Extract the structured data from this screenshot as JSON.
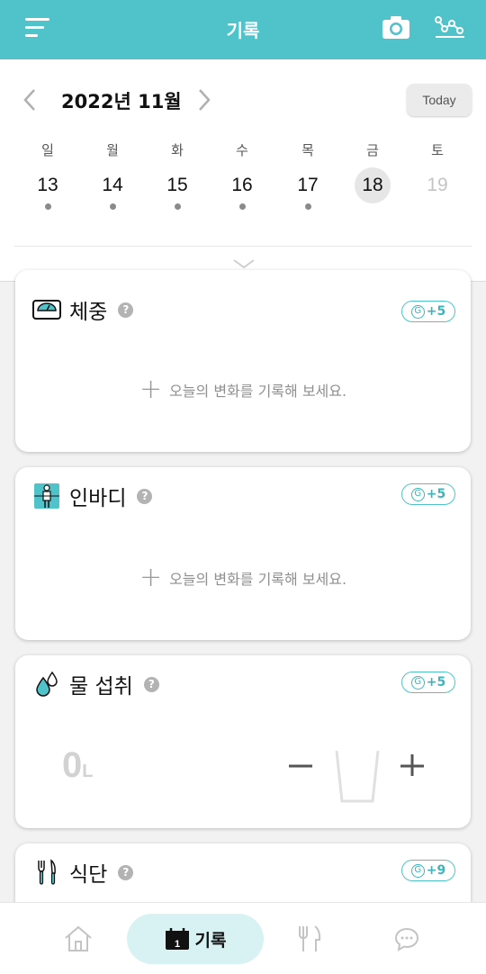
{
  "header": {
    "title": "기록",
    "menu_icon": "menu-icon",
    "camera_icon": "camera-icon",
    "graph_icon": "graph-icon"
  },
  "calendar": {
    "month_title": "2022년 11월",
    "today_label": "Today",
    "days": [
      {
        "dow": "일",
        "date": "13",
        "has_record": true,
        "selected": false,
        "future": false
      },
      {
        "dow": "월",
        "date": "14",
        "has_record": true,
        "selected": false,
        "future": false
      },
      {
        "dow": "화",
        "date": "15",
        "has_record": true,
        "selected": false,
        "future": false
      },
      {
        "dow": "수",
        "date": "16",
        "has_record": true,
        "selected": false,
        "future": false
      },
      {
        "dow": "목",
        "date": "17",
        "has_record": true,
        "selected": false,
        "future": false
      },
      {
        "dow": "금",
        "date": "18",
        "has_record": false,
        "selected": true,
        "future": false
      },
      {
        "dow": "토",
        "date": "19",
        "has_record": false,
        "selected": false,
        "future": true
      }
    ]
  },
  "cards": {
    "weight": {
      "title": "체중",
      "help": "?",
      "badge_g": "G",
      "badge_points": "+5",
      "add_text": "오늘의 변화를 기록해 보세요."
    },
    "inbody": {
      "title": "인바디",
      "help": "?",
      "badge_g": "G",
      "badge_points": "+5",
      "add_text": "오늘의 변화를 기록해 보세요."
    },
    "water": {
      "title": "물 섭취",
      "help": "?",
      "badge_g": "G",
      "badge_points": "+5",
      "amount": "0",
      "unit": "L"
    },
    "diet": {
      "title": "식단",
      "help": "?",
      "badge_g": "G",
      "badge_points": "+9"
    }
  },
  "bottom_nav": {
    "record_label": "기록",
    "record_icon_number": "1"
  },
  "colors": {
    "brand": "#4fc3c9",
    "badge_text": "#39b6bd",
    "record_pill": "#d8f1f2"
  }
}
